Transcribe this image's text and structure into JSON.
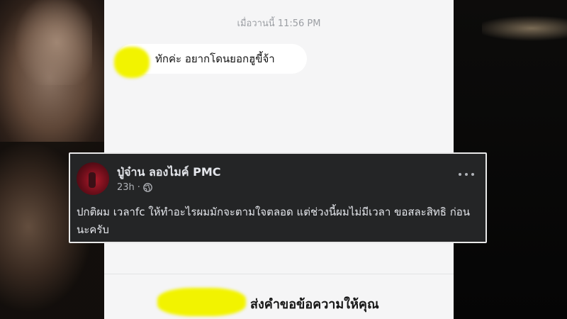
{
  "chat": {
    "timestamp": "เมื่อวานนี้ 11:56 PM",
    "message": "ทักค่ะ อยากโดนยอกฮูขี้จ้า",
    "request_label": "ส่งคำขอข้อความให้คุณ"
  },
  "post": {
    "author": "ปู่จ๋าน ลองไมค์ PMC",
    "time": "23h",
    "separator": "·",
    "privacy_icon": "globe-icon",
    "text": "ปกติผม เวลาfc ให้ทำอะไรผมมักจะตามใจตลอด แต่ช่วงนี้ผมไม่มีเวลา ขอสละสิทธิ ก่อนนะครับ"
  },
  "colors": {
    "highlight": "#f2f300",
    "post_bg": "#242526",
    "chat_bg": "#f5f5f6"
  }
}
